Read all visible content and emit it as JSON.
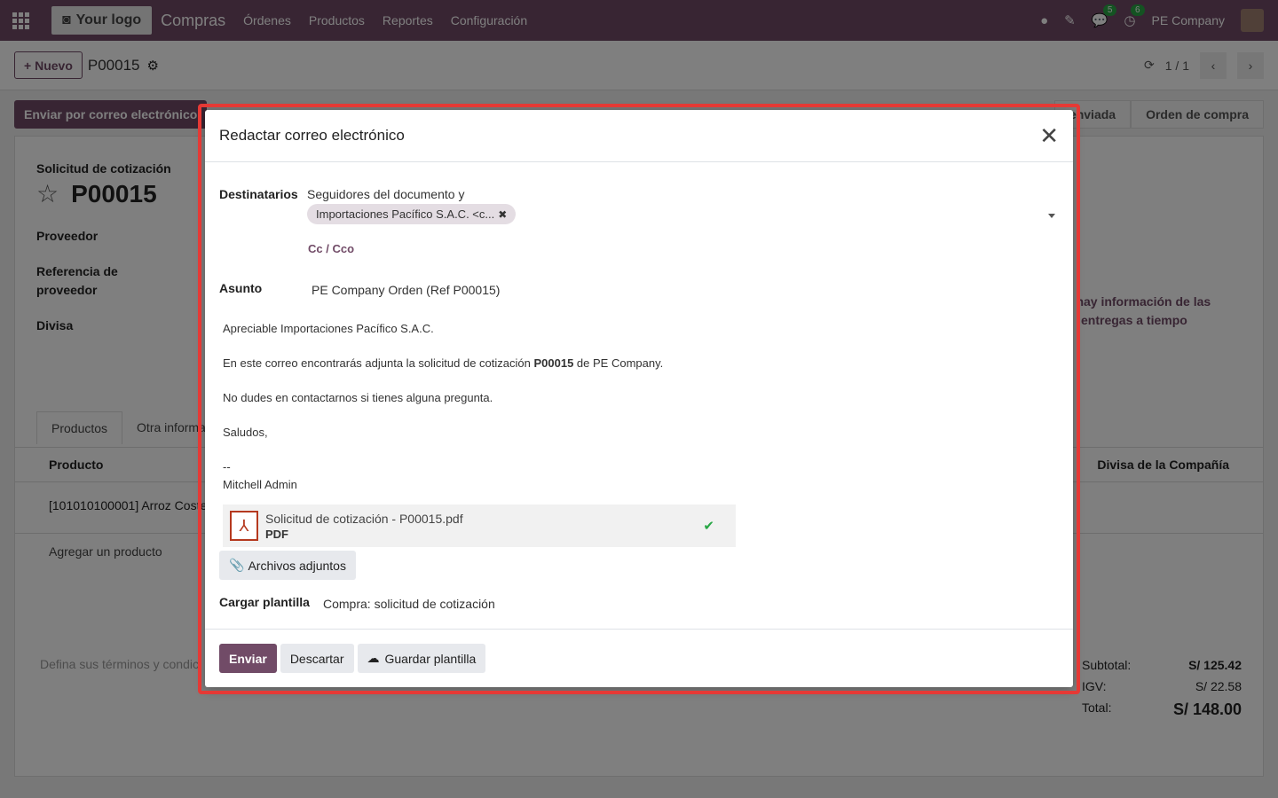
{
  "navbar": {
    "logo": "Your logo",
    "app": "Compras",
    "menus": [
      "Órdenes",
      "Productos",
      "Reportes",
      "Configuración"
    ],
    "badge_chat": "5",
    "badge_activity": "6",
    "company": "PE Company"
  },
  "control": {
    "new_label": "Nuevo",
    "breadcrumb": "P00015",
    "pager": "1 / 1"
  },
  "form_bg": {
    "send_email_btn": "Enviar por correo electrónico",
    "stage_sent": "enviada",
    "stage_po": "Orden de compra",
    "doc_type": "Solicitud de cotización",
    "doc_name": "P00015",
    "label_vendor": "Proveedor",
    "label_vendor_ref_1": "Referencia de",
    "label_vendor_ref_2": "proveedor",
    "label_currency": "Divisa",
    "right_note_1": "o hay información de las",
    "right_note_2": "entregas a tiempo",
    "tab_products": "Productos",
    "tab_other": "Otra informa",
    "col_product": "Producto",
    "col_currency": "Divisa de la Compañía",
    "row_product": "[101010100001] Arroz Coste",
    "add_product": "Agregar un producto",
    "terms_placeholder": "Defina sus términos y condic",
    "subtotal_label": "Subtotal:",
    "subtotal_value": "S/ 125.42",
    "igv_label": "IGV:",
    "igv_value": "S/ 22.58",
    "total_label": "Total:",
    "total_value": "S/ 148.00"
  },
  "modal": {
    "title": "Redactar correo electrónico",
    "recipients_label": "Destinatarios",
    "recipients_prefix": "Seguidores del documento y",
    "recipient_tag": "Importaciones Pacífico S.A.C. <c...",
    "cc_link": "Cc / Cco",
    "subject_label": "Asunto",
    "subject_value": "PE Company Orden (Ref P00015)",
    "body": {
      "greeting": "Apreciable Importaciones Pacífico S.A.C.",
      "line1_pre": "En este correo encontrarás adjunta la solicitud de cotización ",
      "line1_bold": "P00015",
      "line1_post": " de PE Company.",
      "line2": "No dudes en contactarnos si tienes alguna pregunta.",
      "closing": "Saludos,",
      "sig_sep": "--",
      "signature": "Mitchell Admin"
    },
    "attachment_name": "Solicitud de cotización - P00015.pdf",
    "attachment_type": "PDF",
    "attach_btn": "Archivos adjuntos",
    "template_label": "Cargar plantilla",
    "template_value": "Compra: solicitud de cotización",
    "send_btn": "Enviar",
    "discard_btn": "Descartar",
    "save_template_btn": "Guardar plantilla"
  }
}
